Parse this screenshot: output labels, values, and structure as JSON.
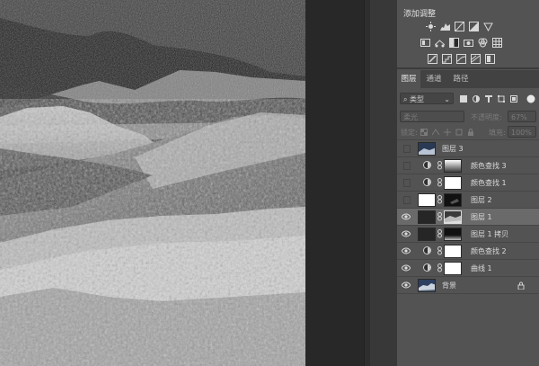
{
  "adjustments": {
    "title": "添加调整"
  },
  "layers_panel": {
    "tabs": [
      "图层",
      "通道",
      "路径"
    ],
    "filter_kind": "类型",
    "blend_mode": "柔光",
    "opacity_label": "不透明度:",
    "opacity_value": "67%",
    "lock_label": "锁定:",
    "fill_label": "填充:",
    "fill_value": "100%",
    "layers": [
      {
        "name": "图层 3",
        "visible": false,
        "selected": false,
        "type": "pixel"
      },
      {
        "name": "颜色查找 3",
        "visible": false,
        "selected": false,
        "type": "adjustment"
      },
      {
        "name": "颜色查找 1",
        "visible": false,
        "selected": false,
        "type": "adjustment"
      },
      {
        "name": "图层 2",
        "visible": false,
        "selected": false,
        "type": "pixel-mask"
      },
      {
        "name": "图层 1",
        "visible": true,
        "selected": true,
        "type": "pixel-mask"
      },
      {
        "name": "图层 1 拷贝",
        "visible": true,
        "selected": false,
        "type": "pixel-mask"
      },
      {
        "name": "颜色查找 2",
        "visible": true,
        "selected": false,
        "type": "adjustment"
      },
      {
        "name": "曲线 1",
        "visible": true,
        "selected": false,
        "type": "adjustment"
      },
      {
        "name": "背景",
        "visible": true,
        "selected": false,
        "type": "background",
        "locked": true
      }
    ]
  },
  "colors": {
    "panel_bg": "#535353",
    "selected_row": "#6a6a6a",
    "workspace_bg": "#282828"
  }
}
